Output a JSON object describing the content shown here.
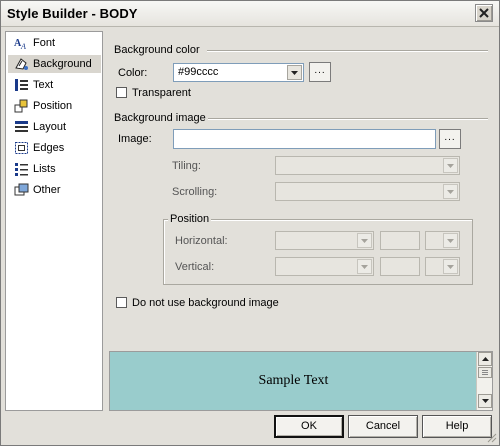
{
  "window": {
    "title": "Style Builder - BODY"
  },
  "sidebar": {
    "items": [
      {
        "label": "Font",
        "icon": "font-icon"
      },
      {
        "label": "Background",
        "icon": "background-icon",
        "selected": true
      },
      {
        "label": "Text",
        "icon": "text-icon"
      },
      {
        "label": "Position",
        "icon": "position-icon"
      },
      {
        "label": "Layout",
        "icon": "layout-icon"
      },
      {
        "label": "Edges",
        "icon": "edges-icon"
      },
      {
        "label": "Lists",
        "icon": "lists-icon"
      },
      {
        "label": "Other",
        "icon": "other-icon"
      }
    ]
  },
  "background_color": {
    "section_title": "Background color",
    "color_label": "Color:",
    "color_value": "#99cccc",
    "browse_label": "...",
    "transparent_label": "Transparent",
    "transparent_checked": false
  },
  "background_image": {
    "section_title": "Background image",
    "image_label": "Image:",
    "image_value": "",
    "browse_label": "...",
    "tiling_label": "Tiling:",
    "scrolling_label": "Scrolling:",
    "position_group": "Position",
    "horizontal_label": "Horizontal:",
    "vertical_label": "Vertical:",
    "no_image_label": "Do not use background image",
    "no_image_checked": false
  },
  "preview": {
    "sample_text": "Sample Text",
    "background_color": "#99cccc"
  },
  "buttons": {
    "ok": "OK",
    "cancel": "Cancel",
    "help": "Help"
  },
  "colors": {
    "dialog_bg": "#e2e0da",
    "title_bg": "#f0efeb",
    "selected_item_bg": "#d9d6cf"
  }
}
